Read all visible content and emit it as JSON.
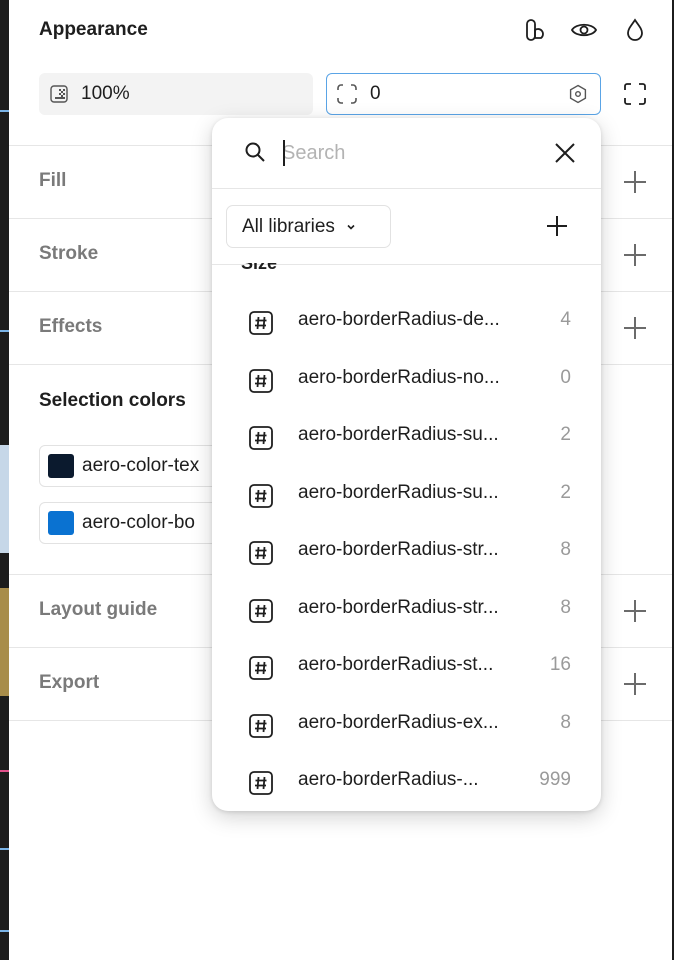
{
  "appearance": {
    "title": "Appearance",
    "opacity_value": "100%",
    "radius_value": "0"
  },
  "sections": {
    "fill": "Fill",
    "stroke": "Stroke",
    "effects": "Effects",
    "selection_colors": "Selection colors",
    "layout_guide": "Layout guide",
    "export": "Export"
  },
  "selection_colors": [
    {
      "name": "aero-color-tex",
      "color": "#0b1a2e"
    },
    {
      "name": "aero-color-bo",
      "color": "#0a72d1"
    }
  ],
  "popover": {
    "search_placeholder": "Search",
    "library_filter": "All libraries",
    "group_label": "Size",
    "variables": [
      {
        "name": "aero-borderRadius-de...",
        "value": "4"
      },
      {
        "name": "aero-borderRadius-no...",
        "value": "0"
      },
      {
        "name": "aero-borderRadius-su...",
        "value": "2"
      },
      {
        "name": "aero-borderRadius-su...",
        "value": "2"
      },
      {
        "name": "aero-borderRadius-str...",
        "value": "8"
      },
      {
        "name": "aero-borderRadius-str...",
        "value": "8"
      },
      {
        "name": "aero-borderRadius-st...",
        "value": "16"
      },
      {
        "name": "aero-borderRadius-ex...",
        "value": "8"
      },
      {
        "name": "aero-borderRadius-...",
        "value": "999"
      }
    ]
  },
  "colors": {
    "accent_border": "#5aa4e6",
    "canvas": "#1c1c1c"
  }
}
